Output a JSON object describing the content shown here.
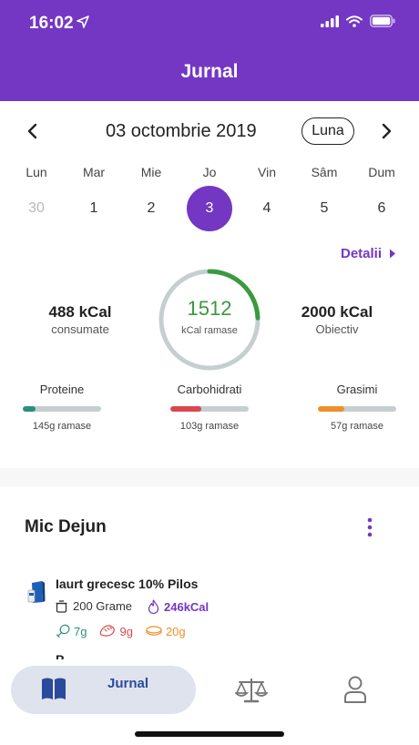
{
  "status_bar": {
    "time": "16:02",
    "icons": [
      "location-arrow-icon",
      "signal-icon",
      "wifi-icon",
      "battery-icon"
    ]
  },
  "header": {
    "title": "Jurnal",
    "color": "#7337c4"
  },
  "date_nav": {
    "date": "03 octombrie 2019",
    "period_button": "Luna"
  },
  "week": [
    {
      "name": "Lun",
      "num": "30"
    },
    {
      "name": "Mar",
      "num": "1"
    },
    {
      "name": "Mie",
      "num": "2"
    },
    {
      "name": "Jo",
      "num": "3"
    },
    {
      "name": "Vin",
      "num": "4"
    },
    {
      "name": "Sâm",
      "num": "5"
    },
    {
      "name": "Dum",
      "num": "6"
    }
  ],
  "details_link": "Detalii",
  "summary": {
    "consumed_value": "488 kCal",
    "consumed_label": "consumate",
    "remaining_value": "1512",
    "remaining_label": "kCal ramase",
    "goal_value": "2000 kCal",
    "goal_label": "Obiectiv",
    "ring_progress": 0.244
  },
  "macros": [
    {
      "name": "Proteine",
      "left": "145g ramase",
      "progress": 0.16,
      "color": "#2a8f7b"
    },
    {
      "name": "Carbohidrati",
      "left": "103g ramase",
      "progress": 0.4,
      "color": "#d9484f"
    },
    {
      "name": "Grasimi",
      "left": "57g ramase",
      "progress": 0.34,
      "color": "#ef8f2b"
    }
  ],
  "meal": {
    "title": "Mic Dejun",
    "item": {
      "name": "Iaurt grecesc 10% Pilos",
      "quantity": "200 Grame",
      "kcal": "246kCal",
      "protein": "7g",
      "carbs": "9g",
      "fat": "20g"
    },
    "next_item_partial": "P"
  },
  "bottom_nav": {
    "journal_label": "Jurnal"
  }
}
